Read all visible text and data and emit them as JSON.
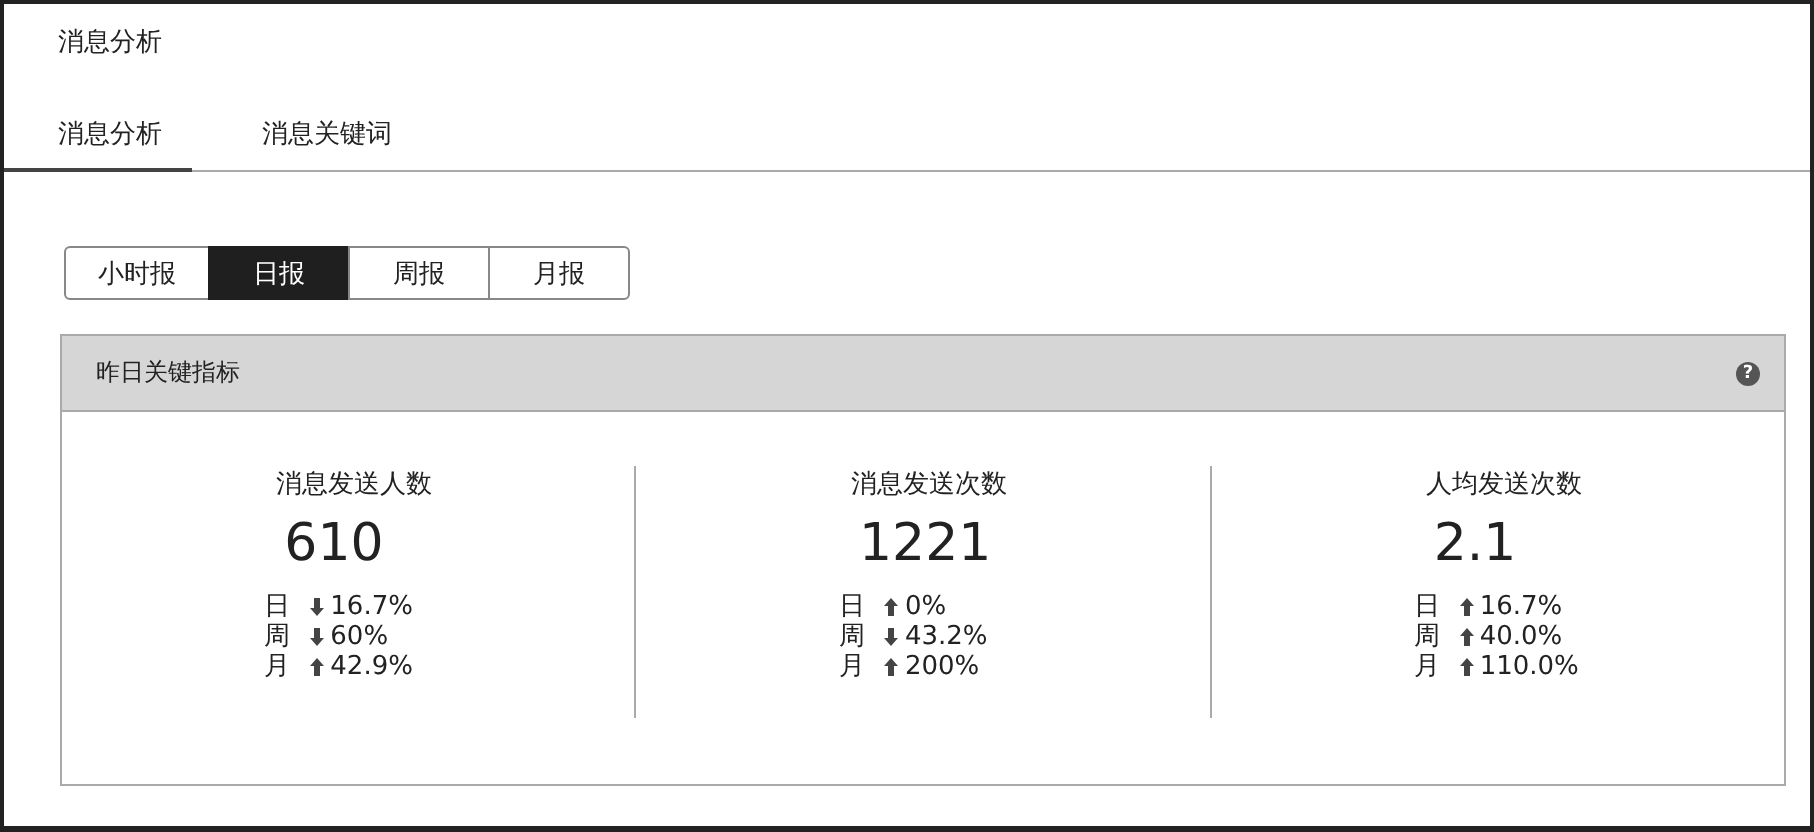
{
  "page_title": "消息分析",
  "tabs": [
    {
      "label": "消息分析",
      "selected": true
    },
    {
      "label": "消息关键词",
      "selected": false
    }
  ],
  "periods": [
    {
      "label": "小时报",
      "selected": false
    },
    {
      "label": "日报",
      "selected": true
    },
    {
      "label": "周报",
      "selected": false
    },
    {
      "label": "月报",
      "selected": false
    }
  ],
  "panel": {
    "title": "昨日关键指标",
    "help_icon": "?",
    "metrics": [
      {
        "label": "消息发送人数",
        "value": "610",
        "changes": [
          {
            "period": "日",
            "rising": false,
            "value": "16.7%"
          },
          {
            "period": "周",
            "rising": false,
            "value": "60%"
          },
          {
            "period": "月",
            "rising": true,
            "value": "42.9%"
          }
        ]
      },
      {
        "label": "消息发送次数",
        "value": "1221",
        "changes": [
          {
            "period": "日",
            "rising": true,
            "value": "0%"
          },
          {
            "period": "周",
            "rising": false,
            "value": "43.2%"
          },
          {
            "period": "月",
            "rising": true,
            "value": "200%"
          }
        ]
      },
      {
        "label": "人均发送次数",
        "value": "2.1",
        "changes": [
          {
            "period": "日",
            "rising": true,
            "value": "16.7%"
          },
          {
            "period": "周",
            "rising": true,
            "value": "40.0%"
          },
          {
            "period": "月",
            "rising": true,
            "value": "110.0%"
          }
        ]
      }
    ]
  }
}
